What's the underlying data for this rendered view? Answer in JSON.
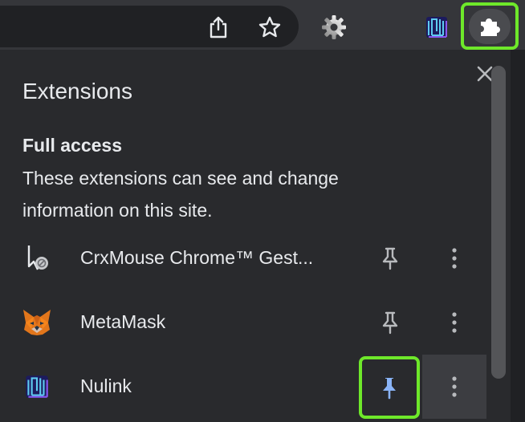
{
  "toolbar": {
    "icons": [
      "share-icon",
      "star-icon",
      "settings-icon",
      "nulink-icon",
      "puzzle-icon"
    ]
  },
  "panel": {
    "title": "Extensions",
    "close_icon": "close-icon",
    "section_title": "Full access",
    "section_desc": "These extensions can see and change information on this site."
  },
  "extensions": [
    {
      "name": "CrxMouse Chrome™ Gest...",
      "icon": "crxmouse-icon",
      "pinned": false
    },
    {
      "name": "MetaMask",
      "icon": "metamask-fox-icon",
      "pinned": false
    },
    {
      "name": "Nulink",
      "icon": "nulink-icon",
      "pinned": true
    }
  ],
  "colors": {
    "highlight": "#6ee82a",
    "pinned": "#8ab4f8",
    "background": "#292a2d"
  }
}
